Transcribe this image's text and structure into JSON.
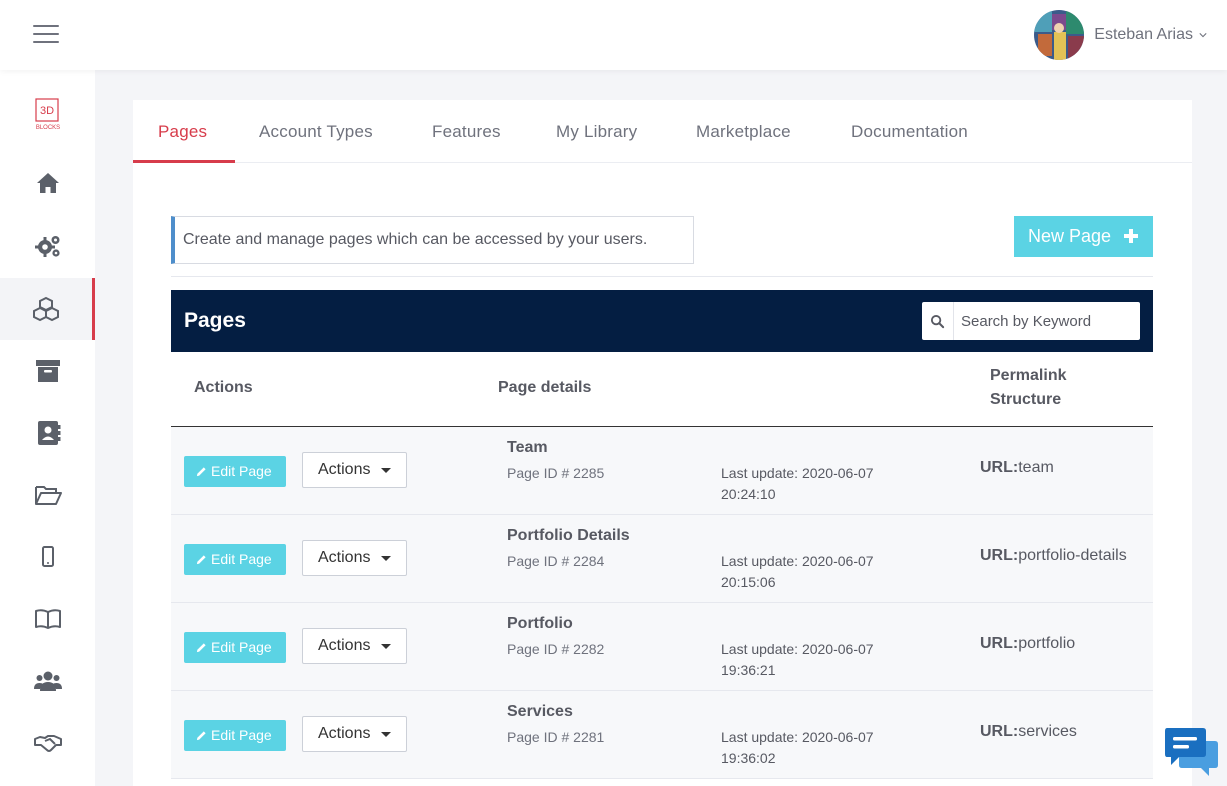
{
  "header": {
    "user_name": "Esteban Arias",
    "menu_icon": "hamburger-icon",
    "dropdown_icon": "chevron-down-icon"
  },
  "sidebar": {
    "logo_text": "3D",
    "logo_subtext": "BLOCKS",
    "items": [
      {
        "icon": "home-icon"
      },
      {
        "icon": "gears-icon"
      },
      {
        "icon": "cubes-icon",
        "active": true
      },
      {
        "icon": "archive-icon"
      },
      {
        "icon": "address-book-icon"
      },
      {
        "icon": "folder-open-icon"
      },
      {
        "icon": "mobile-icon"
      },
      {
        "icon": "book-open-icon"
      },
      {
        "icon": "users-icon"
      },
      {
        "icon": "handshake-icon"
      }
    ]
  },
  "tabs": [
    {
      "label": "Pages",
      "active": true
    },
    {
      "label": "Account Types"
    },
    {
      "label": "Features"
    },
    {
      "label": "My Library"
    },
    {
      "label": "Marketplace"
    },
    {
      "label": "Documentation"
    }
  ],
  "intro_text": "Create and manage pages which can be accessed by your users.",
  "new_page_label": "New Page",
  "table": {
    "title": "Pages",
    "search_placeholder": "Search by Keyword",
    "headers": {
      "actions": "Actions",
      "details": "Page details",
      "permalink_line1": "Permalink",
      "permalink_line2": "Structure"
    },
    "edit_label": "Edit Page",
    "actions_label": "Actions",
    "rows": [
      {
        "title": "Team",
        "page_id": "Page ID # 2285",
        "update_line1": "Last update: 2020-06-07",
        "update_line2": "20:24:10",
        "url_label": "URL:",
        "url_value": "team"
      },
      {
        "title": "Portfolio Details",
        "page_id": "Page ID # 2284",
        "update_line1": "Last update: 2020-06-07",
        "update_line2": "20:15:06",
        "url_label": "URL:",
        "url_value": "portfolio-details"
      },
      {
        "title": "Portfolio",
        "page_id": "Page ID # 2282",
        "update_line1": "Last update: 2020-06-07",
        "update_line2": "19:36:21",
        "url_label": "URL:",
        "url_value": "portfolio"
      },
      {
        "title": "Services",
        "page_id": "Page ID # 2281",
        "update_line1": "Last update: 2020-06-07",
        "update_line2": "19:36:02",
        "url_label": "URL:",
        "url_value": "services"
      }
    ]
  },
  "colors": {
    "accent_red": "#d73c4b",
    "cyan_button": "#5bd3e4",
    "navy_bar": "#041e42",
    "intro_border": "#4e8ecb"
  }
}
